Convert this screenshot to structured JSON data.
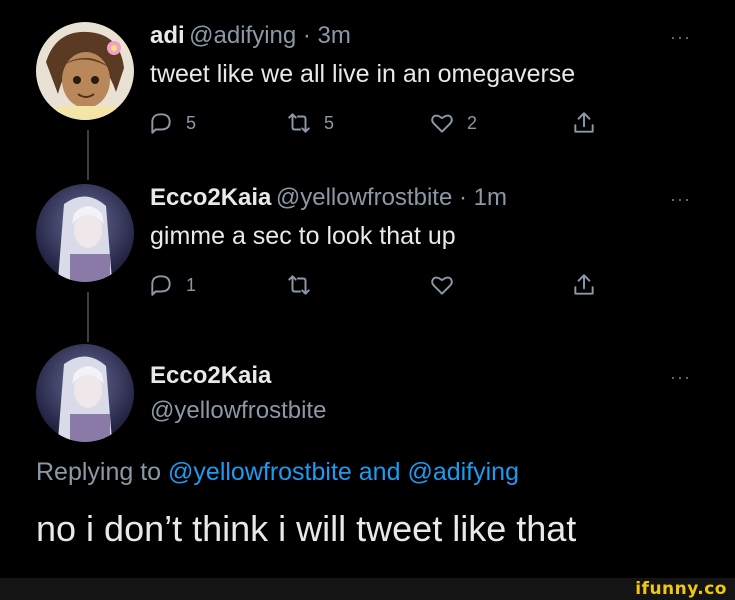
{
  "colors": {
    "background": "#000000",
    "text": "#e7e9ea",
    "muted": "#8b98a5",
    "link": "#1d9bf0",
    "thread_line": "#3a3f44",
    "watermark": "#f2c811"
  },
  "tweet1": {
    "display_name": "adi",
    "handle_time": "@adifying · 3m",
    "text": "tweet like we all live in an omegaverse",
    "more": "···",
    "actions": {
      "reply_icon": "reply-icon",
      "reply_count": "5",
      "retweet_icon": "retweet-icon",
      "retweet_count": "5",
      "like_icon": "heart-icon",
      "like_count": "2",
      "share_icon": "share-icon"
    }
  },
  "tweet2": {
    "display_name": "Ecco2Kaia",
    "handle_time": "@yellowfrostbite · 1m",
    "text": "gimme a sec to look that up",
    "more": "···",
    "actions": {
      "reply_count": "1",
      "retweet_count": "",
      "like_count": ""
    }
  },
  "tweet3": {
    "display_name": "Ecco2Kaia",
    "handle": "@yellowfrostbite",
    "more": "···",
    "replying_prefix": "Replying to",
    "replying_user1": "@yellowfrostbite",
    "replying_and": "and",
    "replying_user2": "@adifying",
    "text": "no i don’t think i will tweet like that"
  },
  "watermark": "ifunny.co"
}
